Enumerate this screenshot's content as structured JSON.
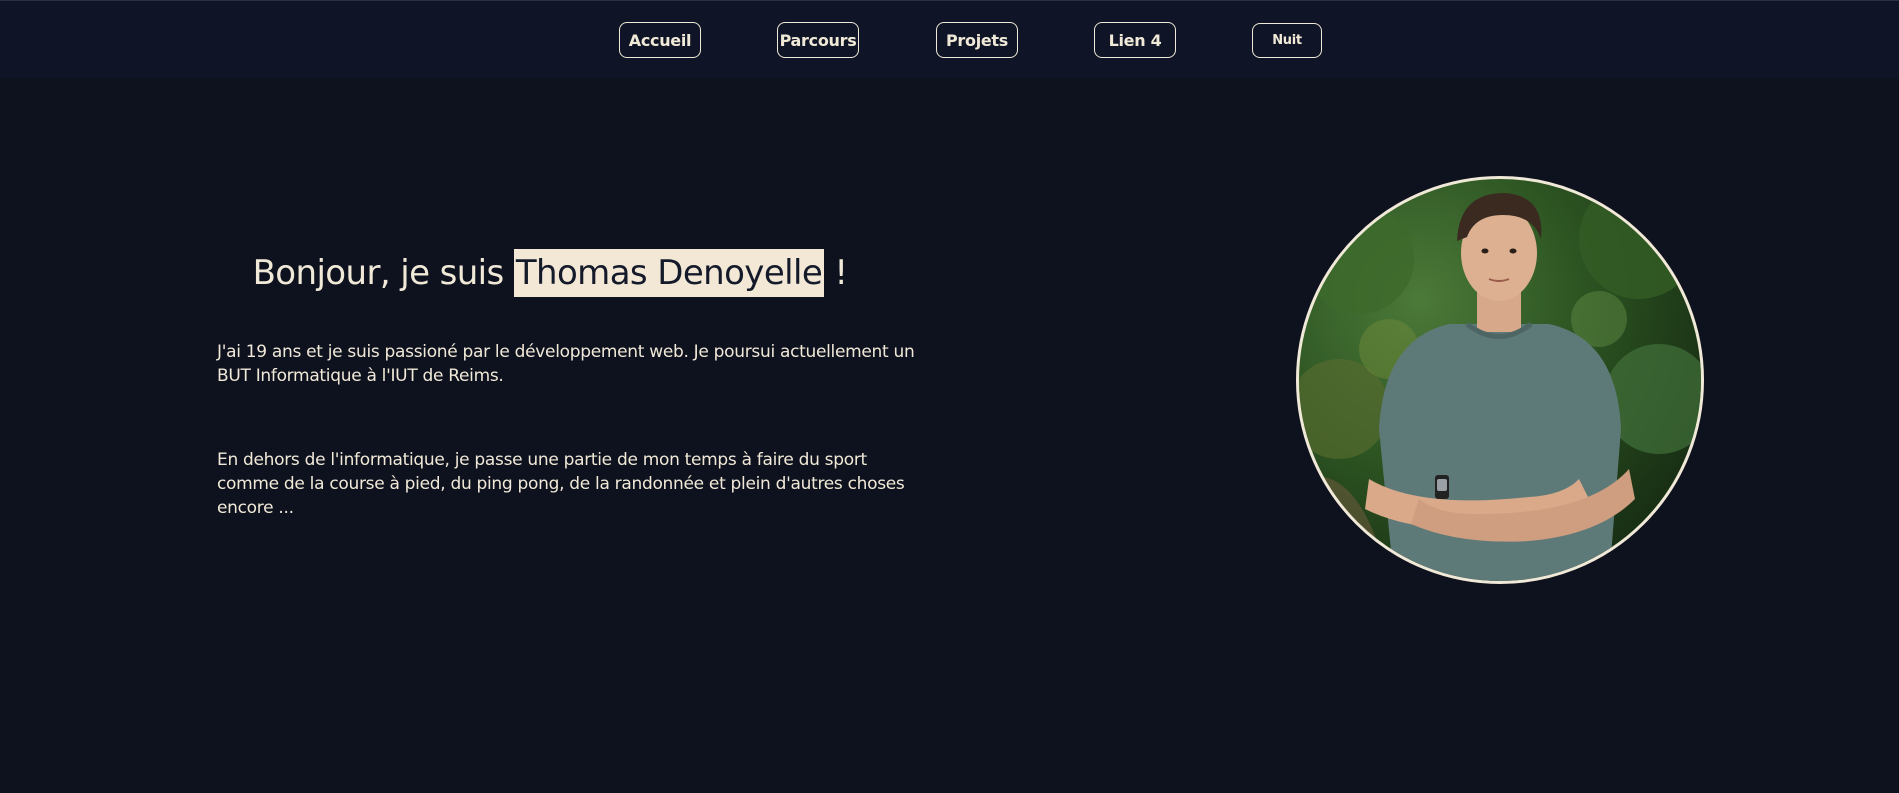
{
  "nav": {
    "items": [
      "Accueil",
      "Parcours",
      "Projets",
      "Lien 4"
    ],
    "theme_toggle": "Nuit"
  },
  "hero": {
    "greeting_prefix": "Bonjour, je suis ",
    "name": "Thomas Denoyelle",
    "greeting_suffix": " !",
    "paragraph_1": "J'ai 19 ans et je suis passioné par le développement web. Je poursui actuellement un BUT Informatique à l'IUT de Reims.",
    "paragraph_2": "En dehors de l'informatique, je passe une partie de mon temps à faire du sport comme de la course à pied, du ping pong, de la randonnée et plein d'autres choses encore ..."
  },
  "colors": {
    "background": "#0e121e",
    "navbar": "#0f1526",
    "text": "#f1e9d8",
    "highlight": "#f3e8d6"
  }
}
